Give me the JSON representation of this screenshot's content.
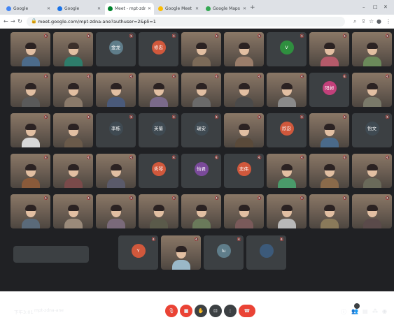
{
  "browser": {
    "tabs": [
      {
        "title": "Google",
        "color": "#4285f4",
        "active": false
      },
      {
        "title": "Google",
        "color": "#1a73e8",
        "active": false
      },
      {
        "title": "Meet - mpt-zdna-ane",
        "color": "#00832d",
        "active": true
      },
      {
        "title": "Google Meet",
        "color": "#fbbc04",
        "active": false
      },
      {
        "title": "Google Maps",
        "color": "#34a853",
        "active": false
      }
    ],
    "new_tab": "+",
    "url": "meet.google.com/mpt-zdna-ane?authuser=2&pli=1",
    "window_controls": {
      "minimize": "–",
      "maximize": "□",
      "close": "✕"
    }
  },
  "meet": {
    "participants": [
      {
        "name": "",
        "kind": "cam",
        "hair": "#2b2222",
        "shirt": "#4c6b8a"
      },
      {
        "name": "",
        "kind": "cam",
        "hair": "#3b2f2a",
        "shirt": "#2e7d6b"
      },
      {
        "name": "",
        "kind": "avatar",
        "initials": "金龙",
        "color": "#5f7d8a"
      },
      {
        "name": "",
        "kind": "avatar",
        "initials": "修忠",
        "color": "#d0583c"
      },
      {
        "name": "",
        "kind": "cam",
        "hair": "#2b2222",
        "shirt": "#7b6a58"
      },
      {
        "name": "",
        "kind": "cam",
        "hair": "#2b2222",
        "shirt": "#9a7d6a"
      },
      {
        "name": "",
        "kind": "avatar",
        "initials": "V",
        "color": "#2f8f3f"
      },
      {
        "name": "",
        "kind": "cam",
        "hair": "#2b2222",
        "shirt": "#b55a6a"
      },
      {
        "name": "",
        "kind": "cam",
        "hair": "#2b2222",
        "shirt": "#6b8a5a"
      },
      {
        "name": "",
        "kind": "cam",
        "hair": "#2b2222",
        "shirt": "#5a5a5a"
      },
      {
        "name": "",
        "kind": "cam",
        "hair": "#2b2222",
        "shirt": "#8a7a6a"
      },
      {
        "name": "",
        "kind": "cam",
        "hair": "#2b2222",
        "shirt": "#4a5a7a"
      },
      {
        "name": "",
        "kind": "cam",
        "hair": "#2b2222",
        "shirt": "#7a6a8a"
      },
      {
        "name": "",
        "kind": "cam",
        "hair": "#2b2222",
        "shirt": "#6a6a6a"
      },
      {
        "name": "",
        "kind": "cam",
        "hair": "#2b2222",
        "shirt": "#4a4a4a"
      },
      {
        "name": "",
        "kind": "cam",
        "hair": "#2b2222",
        "shirt": "#8a8a8a"
      },
      {
        "name": "",
        "kind": "avatar",
        "initials": "阳昶",
        "color": "#c2407a"
      },
      {
        "name": "",
        "kind": "cam",
        "hair": "#2b2222",
        "shirt": "#7a7a6a"
      },
      {
        "name": "",
        "kind": "cam",
        "hair": "#2b2222",
        "shirt": "#d8d8d8"
      },
      {
        "name": "",
        "kind": "cam",
        "hair": "#2b2222",
        "shirt": "#6a5a4a"
      },
      {
        "name": "",
        "kind": "avatar",
        "initials": "李栋",
        "color": "#3f4a52"
      },
      {
        "name": "",
        "kind": "avatar",
        "initials": "英菊",
        "color": "#3f4a52"
      },
      {
        "name": "",
        "kind": "avatar",
        "initials": "瑞安",
        "color": "#3f4a52"
      },
      {
        "name": "",
        "kind": "cam",
        "hair": "#2b2222",
        "shirt": "#5a4a3a"
      },
      {
        "name": "",
        "kind": "avatar",
        "initials": "欣宓",
        "color": "#d0583c"
      },
      {
        "name": "",
        "kind": "cam",
        "hair": "#2b2222",
        "shirt": "#4a6a8a"
      },
      {
        "name": "",
        "kind": "avatar",
        "initials": "怡文",
        "color": "#3f4a52"
      },
      {
        "name": "",
        "kind": "cam",
        "hair": "#2b2222",
        "shirt": "#8a5a3a"
      },
      {
        "name": "",
        "kind": "cam",
        "hair": "#2b2222",
        "shirt": "#7a4a4a"
      },
      {
        "name": "",
        "kind": "cam",
        "hair": "#2b2222",
        "shirt": "#5a5a6a"
      },
      {
        "name": "",
        "kind": "avatar",
        "initials": "秀琴",
        "color": "#d0583c"
      },
      {
        "name": "",
        "kind": "avatar",
        "initials": "怡君",
        "color": "#7a4a9a"
      },
      {
        "name": "",
        "kind": "avatar",
        "initials": "志伟",
        "color": "#d0583c"
      },
      {
        "name": "",
        "kind": "cam",
        "hair": "#2b2222",
        "shirt": "#4a9a6a"
      },
      {
        "name": "",
        "kind": "cam",
        "hair": "#2b2222",
        "shirt": "#8a6a4a"
      },
      {
        "name": "",
        "kind": "cam",
        "hair": "#2b2222",
        "shirt": "#6a6a5a"
      },
      {
        "name": "",
        "kind": "cam",
        "hair": "#2b2222",
        "shirt": "#5a6a7a"
      },
      {
        "name": "",
        "kind": "cam",
        "hair": "#2b2222",
        "shirt": "#9a8a7a"
      },
      {
        "name": "",
        "kind": "cam",
        "hair": "#2b2222",
        "shirt": "#7a6a7a"
      },
      {
        "name": "",
        "kind": "cam",
        "hair": "#2b2222",
        "shirt": "#5a5a4a"
      },
      {
        "name": "",
        "kind": "cam",
        "hair": "#2b2222",
        "shirt": "#6a7a5a"
      },
      {
        "name": "",
        "kind": "cam",
        "hair": "#2b2222",
        "shirt": "#7a5a5a"
      },
      {
        "name": "",
        "kind": "cam",
        "hair": "#2b2222",
        "shirt": "#b8b8b8"
      },
      {
        "name": "",
        "kind": "cam",
        "hair": "#2b2222",
        "shirt": "#8a7a5a"
      },
      {
        "name": "",
        "kind": "cam",
        "hair": "#2b2222",
        "shirt": "#5a4a4a"
      }
    ],
    "bottom_row": [
      {
        "name": "",
        "kind": "avatar",
        "initials": "Y",
        "color": "#d0583c"
      },
      {
        "name": "",
        "kind": "cam",
        "hair": "#2b2222",
        "shirt": "#9ab8c8"
      },
      {
        "name": "",
        "kind": "avatar",
        "initials": "lu",
        "color": "#5f7d8a"
      },
      {
        "name": "",
        "kind": "avatar",
        "initials": "",
        "color": "#3c5a7a"
      }
    ],
    "caption_text": "",
    "clock": "下午3:01",
    "meeting_code": "mpt-zdna-ane",
    "participant_count": "",
    "colors": {
      "background": "#202124",
      "end_call": "#ea4335",
      "tile": "#3c4043"
    }
  }
}
